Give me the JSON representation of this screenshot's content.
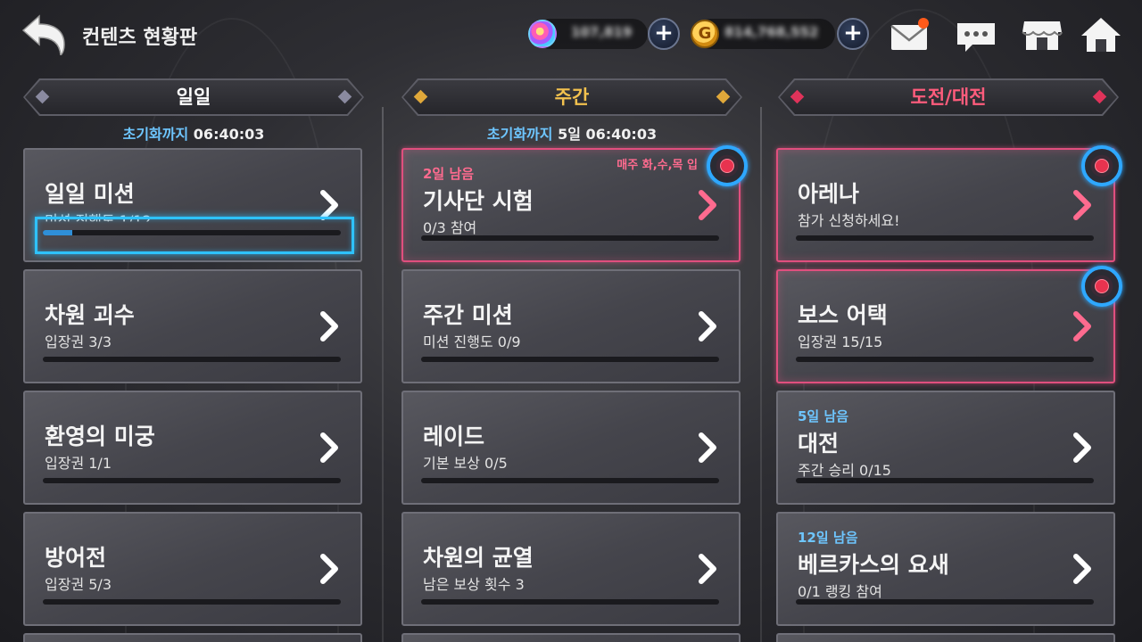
{
  "header": {
    "title": "컨텐츠 현황판",
    "currencies": [
      {
        "icon": "gem-icon",
        "value": "107,819"
      },
      {
        "icon": "gold-coin-icon",
        "symbol": "G",
        "value": "814,768,552"
      }
    ],
    "icons": [
      "mail-icon",
      "chat-icon",
      "shop-icon",
      "home-icon"
    ],
    "mail_notification": true
  },
  "columns": [
    {
      "header": "일일",
      "header_color": "#ffffff",
      "diamond_color": "#8a8aa0",
      "reset_label": "초기화까지",
      "reset_time": "06:40:03",
      "cards": [
        {
          "title": "일일 미션",
          "sub": "미션 진행도 1/12",
          "progress": 0.1,
          "pink": false,
          "highlighted": true
        },
        {
          "title": "차원 괴수",
          "sub": "입장권 3/3",
          "progress": 0,
          "pink": false
        },
        {
          "title": "환영의 미궁",
          "sub": "입장권 1/1",
          "progress": 0,
          "pink": false
        },
        {
          "title": "방어전",
          "sub": "입장권 5/3",
          "progress": 0,
          "pink": false
        }
      ]
    },
    {
      "header": "주간",
      "header_color": "#f2c14e",
      "diamond_color": "#e0a83a",
      "reset_label": "초기화까지",
      "reset_time": "5일 06:40:03",
      "cards": [
        {
          "remain": "2일 남음",
          "remain_color": "#ff6b8f",
          "title": "기사단 시험",
          "sub": "0/3 참여",
          "note": "매주 화,수,목 입",
          "progress": 0,
          "pink": true,
          "badge": true
        },
        {
          "title": "주간 미션",
          "sub": "미션 진행도 0/9",
          "progress": 0,
          "pink": false
        },
        {
          "title": "레이드",
          "sub": "기본 보상 0/5",
          "progress": 0,
          "pink": false
        },
        {
          "title": "차원의 균열",
          "sub": "남은 보상 횟수 3",
          "progress": 0,
          "pink": false
        }
      ]
    },
    {
      "header": "도전/대전",
      "header_color": "#ff5c7c",
      "diamond_color": "#e0335a",
      "reset_label": "",
      "reset_time": "",
      "cards": [
        {
          "title": "아레나",
          "sub": "참가 신청하세요!",
          "progress": 0,
          "pink": true,
          "badge": true
        },
        {
          "title": "보스 어택",
          "sub": "입장권 15/15",
          "progress": 0,
          "pink": true,
          "badge": true
        },
        {
          "remain": "5일 남음",
          "remain_color": "#6ec6ff",
          "title": "대전",
          "sub": "주간 승리 0/15",
          "progress": 0,
          "pink": false
        },
        {
          "remain": "12일 남음",
          "remain_color": "#6ec6ff",
          "title": "베르카스의 요새",
          "sub": "0/1 랭킹 참여",
          "progress": 0,
          "pink": false
        }
      ]
    }
  ]
}
